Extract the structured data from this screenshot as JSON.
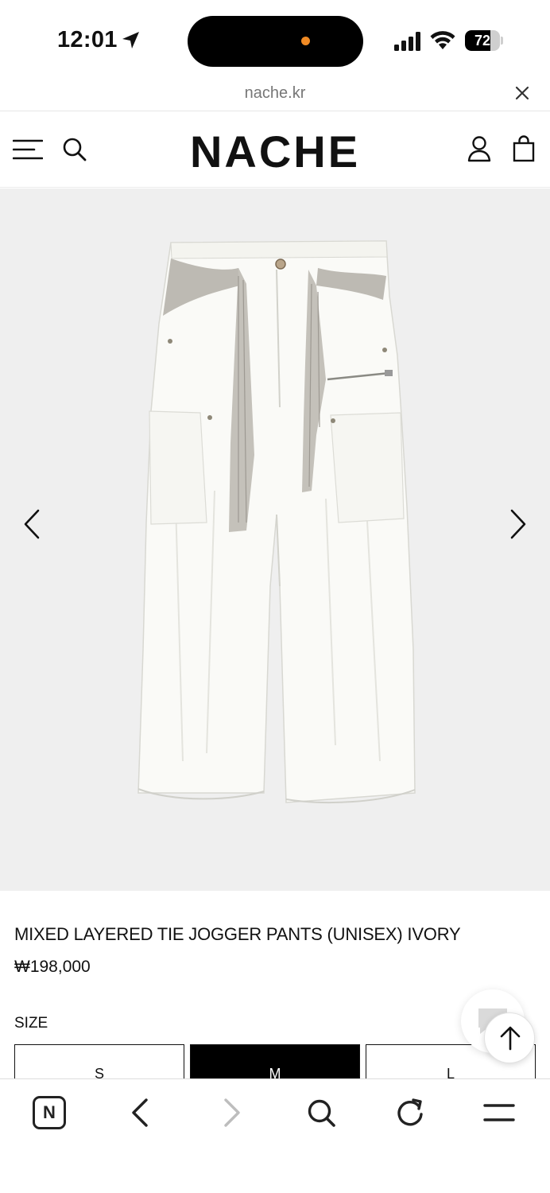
{
  "status_bar": {
    "time": "12:01",
    "battery_percent": "72",
    "battery_level": 0.72
  },
  "browser": {
    "url": "nache.kr",
    "toolbar_n_label": "N"
  },
  "site": {
    "logo": "NACHE"
  },
  "product": {
    "name": "MIXED LAYERED TIE JOGGER PANTS (UNISEX) IVORY",
    "price": "₩198,000",
    "size_label": "SIZE",
    "sizes": [
      "S",
      "M",
      "L"
    ],
    "selected_size": "M"
  },
  "colors": {
    "gallery_background": "#efefef",
    "accent": "#000000",
    "island_dot": "#f08a24"
  },
  "icons": {
    "header": [
      "menu-icon",
      "search-icon",
      "user-icon",
      "bag-icon"
    ],
    "toolbar": [
      "n-icon",
      "back-icon",
      "forward-icon",
      "search-icon",
      "reload-icon",
      "menu-icon"
    ]
  }
}
